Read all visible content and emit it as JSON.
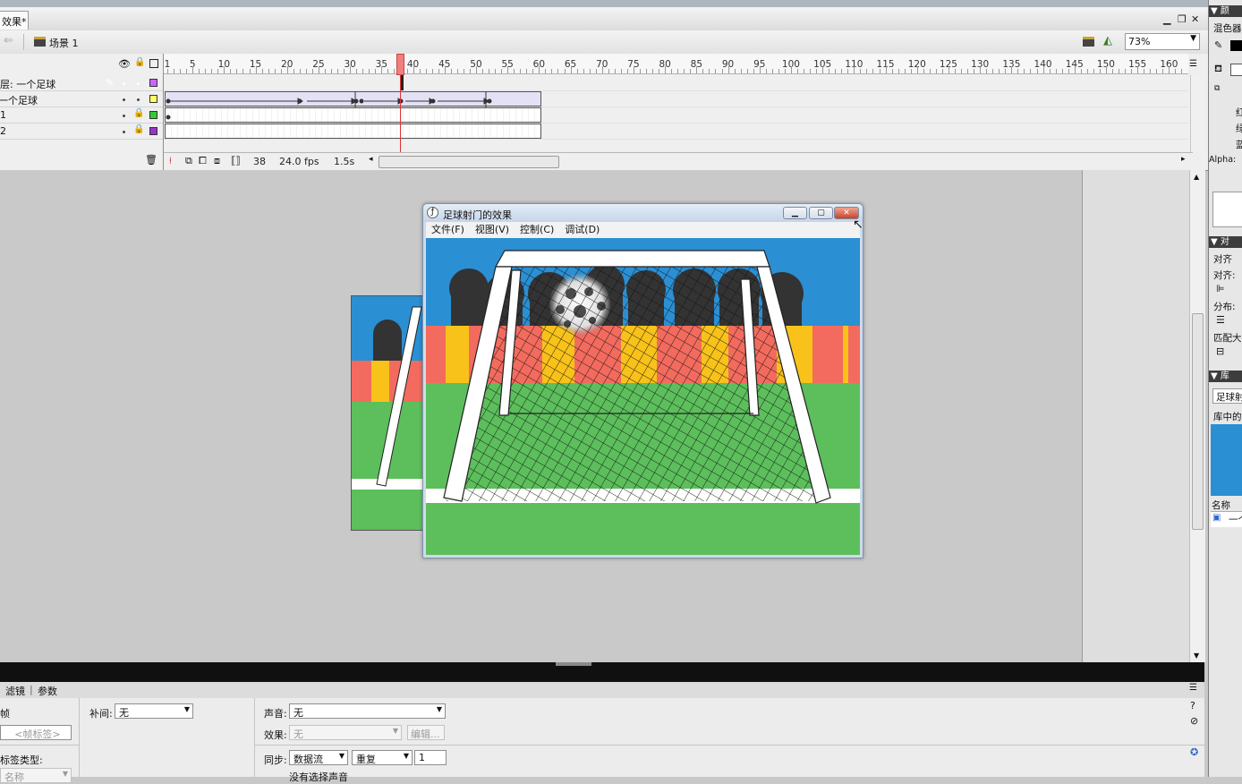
{
  "document": {
    "tab_title": "效果*",
    "scene_label": "场景 1",
    "zoom": "73%"
  },
  "timeline": {
    "layers": [
      {
        "name": "层: 一个足球",
        "color": "#cc66ff",
        "selected": true
      },
      {
        "name": "一个足球",
        "color": "#ffff66",
        "selected": false
      },
      {
        "name": "1",
        "color": "#33cc33",
        "selected": false
      },
      {
        "name": "2",
        "color": "#9933cc",
        "selected": false
      }
    ],
    "ruler_ticks": [
      "1",
      "5",
      "10",
      "15",
      "20",
      "25",
      "30",
      "35",
      "40",
      "45",
      "50",
      "55",
      "60",
      "65",
      "70",
      "75",
      "80",
      "85",
      "90",
      "95",
      "100",
      "105",
      "110",
      "115",
      "120",
      "125",
      "130",
      "135",
      "140",
      "145",
      "150",
      "155",
      "160"
    ],
    "current_frame": "38",
    "frame_rate": "24.0 fps",
    "elapsed": "1.5s"
  },
  "preview_window": {
    "title": "足球射门的效果",
    "menu": [
      "文件(F)",
      "视图(V)",
      "控制(C)",
      "调试(D)"
    ]
  },
  "right_panel": {
    "color_header": "▼ 颜",
    "mixer": "混色器",
    "red": "红:",
    "green": "绿:",
    "blue": "蓝:",
    "alpha": "Alpha:",
    "align_header": "▼ 对",
    "align_tab": "对齐",
    "align_label": "对齐:",
    "distribute_label": "分布:",
    "match_size_label": "匹配大",
    "library_header": "▼ 库",
    "library_doc": "足球射",
    "library_count": "库中的",
    "library_name_col": "名称",
    "library_item": "一个"
  },
  "properties": {
    "tabs": [
      "滤镜",
      "参数"
    ],
    "frame_label_placeholder": "<帧标签>",
    "label_type_label": "标签类型:",
    "label_type_value": "名称",
    "tween_label": "补间:",
    "tween_value": "无",
    "sound_label": "声音:",
    "sound_value": "无",
    "effect_label": "效果:",
    "effect_value": "无",
    "edit_button": "编辑...",
    "sync_label": "同步:",
    "sync_value": "数据流",
    "repeat_value": "重复",
    "repeat_count": "1",
    "no_sound": "没有选择声音"
  },
  "colors": {
    "sky": "#2b8fd3",
    "pitch": "#5cbf5c",
    "stand_red": "#f36b5e",
    "stand_yellow": "#f8c21a",
    "selection": "#3a73d6",
    "playhead": "#f07f7f"
  }
}
